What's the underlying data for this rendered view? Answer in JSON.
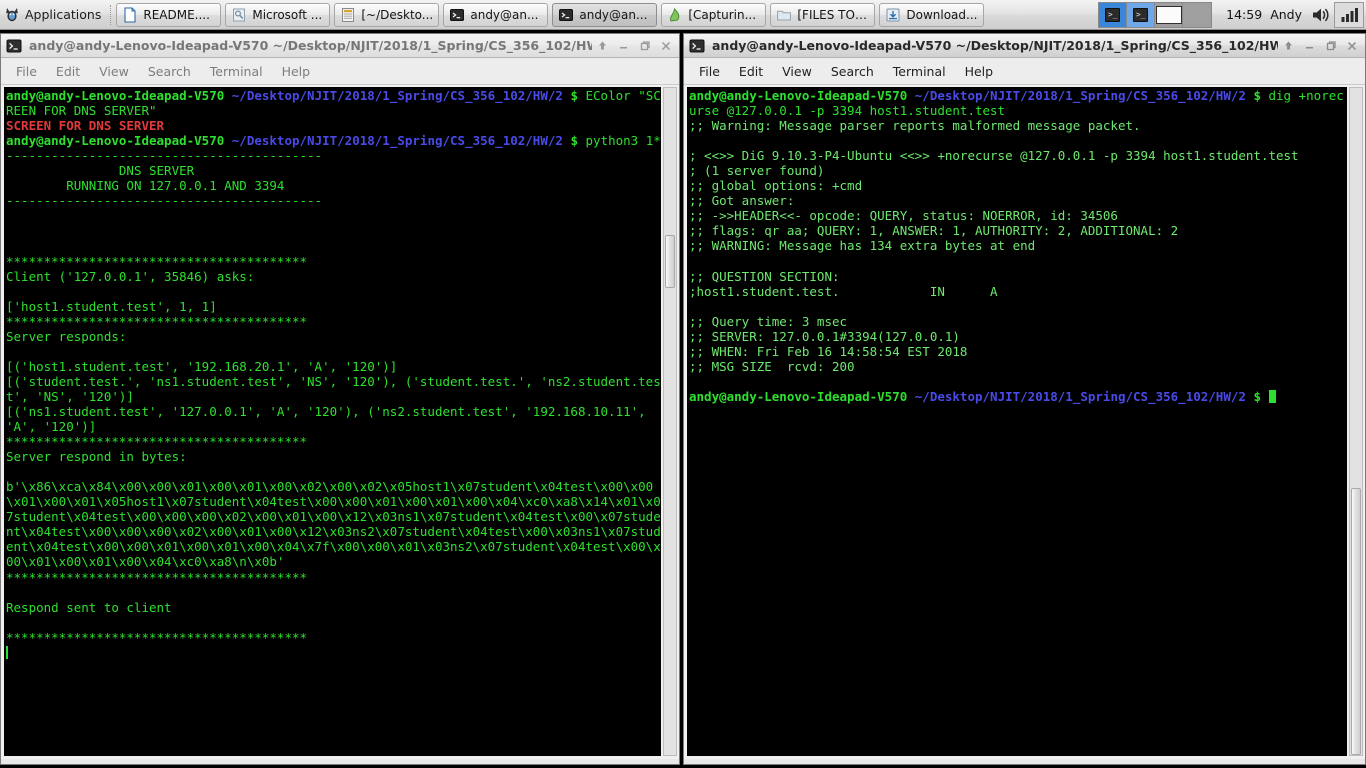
{
  "taskbar": {
    "applications_label": "Applications",
    "applications_icon": "xfce-mouse-icon",
    "windows": [
      {
        "label": "README....",
        "icon": "document-icon"
      },
      {
        "label": "Microsoft ...",
        "icon": "image-viewer-icon",
        "active": false
      },
      {
        "label": "[~/Deskto...",
        "icon": "file-manager-icon"
      },
      {
        "label": "andy@an...",
        "icon": "terminal-icon"
      },
      {
        "label": "andy@an...",
        "icon": "terminal-icon",
        "active": true
      },
      {
        "label": "[Capturin...",
        "icon": "screen-recorder-icon"
      },
      {
        "label": "[FILES TO ...",
        "icon": "folder-icon"
      },
      {
        "label": "Download...",
        "icon": "download-icon"
      }
    ],
    "workspaces": [
      {
        "name": "workspace-1",
        "icon": "terminal-icon",
        "state": "active"
      },
      {
        "name": "workspace-2",
        "icon": "terminal-icon",
        "state": "current"
      },
      {
        "name": "workspace-3",
        "icon": "window-icon",
        "state": "idle"
      },
      {
        "name": "workspace-4",
        "icon": "empty",
        "state": "idle"
      }
    ],
    "clock": "14:59",
    "user": "Andy",
    "tray": [
      {
        "name": "volume-icon"
      },
      {
        "name": "network-signal-icon"
      }
    ]
  },
  "window_left": {
    "title": "andy@andy-Lenovo-Ideapad-V570 ~/Desktop/NJIT/2018/1_Spring/CS_356_102/HW/",
    "icon": "terminal-icon",
    "focused": false,
    "buttons": [
      {
        "name": "shade-button",
        "glyph": "shade"
      },
      {
        "name": "minimize-button",
        "glyph": "minimize"
      },
      {
        "name": "maximize-button",
        "glyph": "maximize"
      },
      {
        "name": "close-button",
        "glyph": "close"
      }
    ],
    "menu": [
      "File",
      "Edit",
      "View",
      "Search",
      "Terminal",
      "Help"
    ],
    "prompt": {
      "userhost": "andy@andy-Lenovo-Ideapad-V570",
      "path": "~/Desktop/NJIT/2018/1_Spring/CS_356_102/HW/2",
      "sign": "$"
    },
    "cmd1": " EColor \"SCREEN FOR DNS SERVER\"",
    "banner_red": "SCREEN FOR DNS SERVER",
    "cmd2": " python3 1*",
    "body": "\n------------------------------------------\n               DNS SERVER\n        RUNNING ON 127.0.0.1 AND 3394\n------------------------------------------\n\n\n\n****************************************\nClient ('127.0.0.1', 35846) asks:\n\n['host1.student.test', 1, 1]\n****************************************\nServer responds:\n\n[('host1.student.test', '192.168.20.1', 'A', '120')]\n[('student.test.', 'ns1.student.test', 'NS', '120'), ('student.test.', 'ns2.student.test', 'NS', '120')]\n[('ns1.student.test', '127.0.0.1', 'A', '120'), ('ns2.student.test', '192.168.10.11', 'A', '120')]\n****************************************\nServer respond in bytes:\n\nb'\\x86\\xca\\x84\\x00\\x00\\x01\\x00\\x01\\x00\\x02\\x00\\x02\\x05host1\\x07student\\x04test\\x00\\x00\\x01\\x00\\x01\\x05host1\\x07student\\x04test\\x00\\x00\\x01\\x00\\x01\\x00\\x04\\xc0\\xa8\\x14\\x01\\x07student\\x04test\\x00\\x00\\x00\\x02\\x00\\x01\\x00\\x12\\x03ns1\\x07student\\x04test\\x00\\x07student\\x04test\\x00\\x00\\x00\\x02\\x00\\x01\\x00\\x12\\x03ns2\\x07student\\x04test\\x00\\x03ns1\\x07student\\x04test\\x00\\x00\\x01\\x00\\x01\\x00\\x04\\x7f\\x00\\x00\\x01\\x03ns2\\x07student\\x04test\\x00\\x00\\x01\\x00\\x01\\x00\\x04\\xc0\\xa8\\n\\x0b'\n****************************************\n\nRespond sent to client\n\n****************************************\n"
  },
  "window_right": {
    "title": "andy@andy-Lenovo-Ideapad-V570 ~/Desktop/NJIT/2018/1_Spring/CS_356_102/HW/",
    "icon": "terminal-icon",
    "focused": true,
    "buttons": [
      {
        "name": "shade-button",
        "glyph": "shade"
      },
      {
        "name": "minimize-button",
        "glyph": "minimize"
      },
      {
        "name": "maximize-button",
        "glyph": "maximize"
      },
      {
        "name": "close-button",
        "glyph": "close"
      }
    ],
    "menu": [
      "File",
      "Edit",
      "View",
      "Search",
      "Terminal",
      "Help"
    ],
    "prompt": {
      "userhost": "andy@andy-Lenovo-Ideapad-V570",
      "path": "~/Desktop/NJIT/2018/1_Spring/CS_356_102/HW/2",
      "sign": "$"
    },
    "cmd1": " dig +norecurse @127.0.0.1 -p 3394 host1.student.test",
    "body": ";; Warning: Message parser reports malformed message packet.\n\n; <<>> DiG 9.10.3-P4-Ubuntu <<>> +norecurse @127.0.0.1 -p 3394 host1.student.test\n; (1 server found)\n;; global options: +cmd\n;; Got answer:\n;; ->>HEADER<<- opcode: QUERY, status: NOERROR, id: 34506\n;; flags: qr aa; QUERY: 1, ANSWER: 1, AUTHORITY: 2, ADDITIONAL: 2\n;; WARNING: Message has 134 extra bytes at end\n\n;; QUESTION SECTION:\n;host1.student.test.\t\tIN\tA\n\n;; Query time: 3 msec\n;; SERVER: 127.0.0.1#3394(127.0.0.1)\n;; WHEN: Fri Feb 16 14:58:54 EST 2018\n;; MSG SIZE  rcvd: 200\n",
    "prompt2": {
      "userhost": "andy@andy-Lenovo-Ideapad-V570",
      "path": "~/Desktop/NJIT/2018/1_Spring/CS_356_102/HW/2",
      "sign": "$"
    }
  },
  "colors": {
    "terminal_bg": "#000000",
    "terminal_green": "#2ee02e",
    "prompt_path_blue": "#4a4ae8",
    "banner_red": "#e03a3a",
    "taskbar_bg": "#e4e4e4",
    "workspace_active": "#3a86d8"
  }
}
